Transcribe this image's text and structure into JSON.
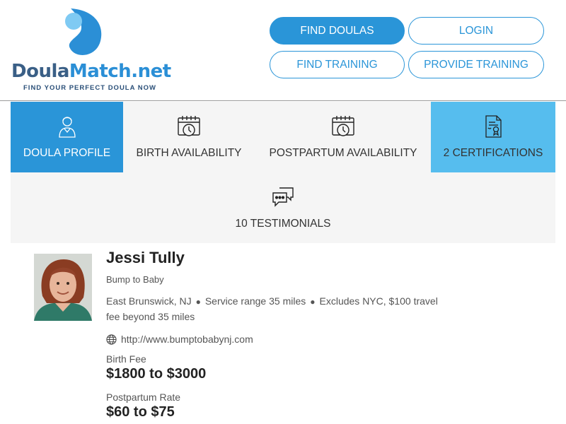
{
  "logo": {
    "name_part1": "Doula",
    "name_part2": "Match.net",
    "tagline": "FIND YOUR PERFECT DOULA NOW"
  },
  "nav": {
    "find_doulas": "FIND DOULAS",
    "login": "LOGIN",
    "find_training": "FIND TRAINING",
    "provide_training": "PROVIDE TRAINING"
  },
  "tabs": [
    {
      "label": "DOULA PROFILE",
      "icon": "doula-profile-icon",
      "active": true
    },
    {
      "label": "BIRTH AVAILABILITY",
      "icon": "calendar-clock-icon"
    },
    {
      "label": "POSTPARTUM AVAILABILITY",
      "icon": "calendar-clock-icon"
    },
    {
      "label": "2 CERTIFICATIONS",
      "icon": "certificate-icon"
    },
    {
      "label": "10 TESTIMONIALS",
      "icon": "chat-bubbles-icon"
    }
  ],
  "profile": {
    "name": "Jessi Tully",
    "business": "Bump to Baby",
    "location": "East Brunswick, NJ",
    "service_range": "Service range 35 miles",
    "excludes": "Excludes NYC, $100 travel fee beyond 35 miles",
    "website": "http://www.bumptobabynj.com",
    "birth_fee_label": "Birth Fee",
    "birth_fee": "$1800 to $3000",
    "postpartum_label": "Postpartum Rate",
    "postpartum_rate": "$60 to $75"
  },
  "colors": {
    "primary": "#2a95d8",
    "accent": "#56bdee",
    "tab_bg": "#f5f5f5"
  }
}
